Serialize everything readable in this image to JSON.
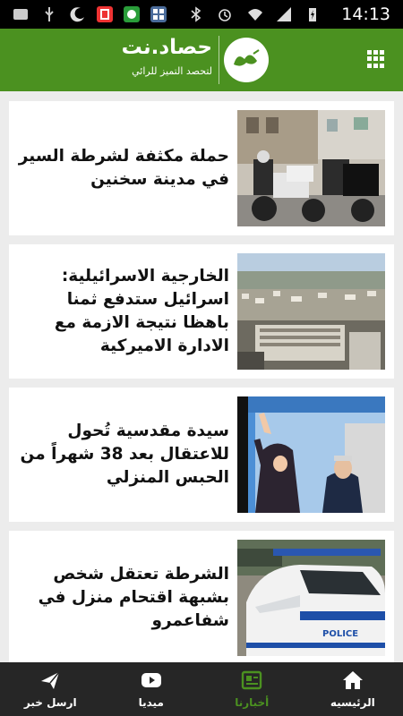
{
  "status_bar": {
    "time": "14:13",
    "icons": [
      "notification-icon",
      "usb-icon",
      "do-not-disturb-icon",
      "app-red-icon",
      "app-green-icon",
      "app-grid-icon",
      "bluetooth-icon",
      "alarm-icon",
      "wifi-icon",
      "signal-icon",
      "battery-charging-icon"
    ]
  },
  "header": {
    "brand_name": "حصاد.نت",
    "brand_tagline": "لتحصد التميز للرائي",
    "logo_text": "حصاد",
    "menu_icon": "grid-menu-icon",
    "brand_color": "#4b9120"
  },
  "articles": [
    {
      "title": "حملة مكثفة لشرطة السير في مدينة سخنين",
      "thumb": "police-motorcycles-photo"
    },
    {
      "title": "الخارجية الاسرائيلية: اسرائيل ستدفع ثمنا باهظا نتيجة الازمة مع الادارة الاميركية",
      "thumb": "city-skyline-photo"
    },
    {
      "title": "سيدة مقدسية تُحول للاعتقال بعد 38 شهراً من الحبس المنزلي",
      "thumb": "woman-waving-photo"
    },
    {
      "title": "الشرطة تعتقل شخص بشبهة اقتحام منزل في شفاعمرو",
      "thumb": "police-car-photo"
    }
  ],
  "bottom_nav": [
    {
      "label": "الرئيسيه",
      "icon": "home-icon",
      "active": false
    },
    {
      "label": "أخبارنا",
      "icon": "news-icon",
      "active": true
    },
    {
      "label": "ميديا",
      "icon": "youtube-play-icon",
      "active": false
    },
    {
      "label": "ارسل خبر",
      "icon": "send-icon",
      "active": false
    }
  ],
  "colors": {
    "accent": "#4b9120",
    "nav_bg": "#262626",
    "active_nav": "#4b9120"
  }
}
